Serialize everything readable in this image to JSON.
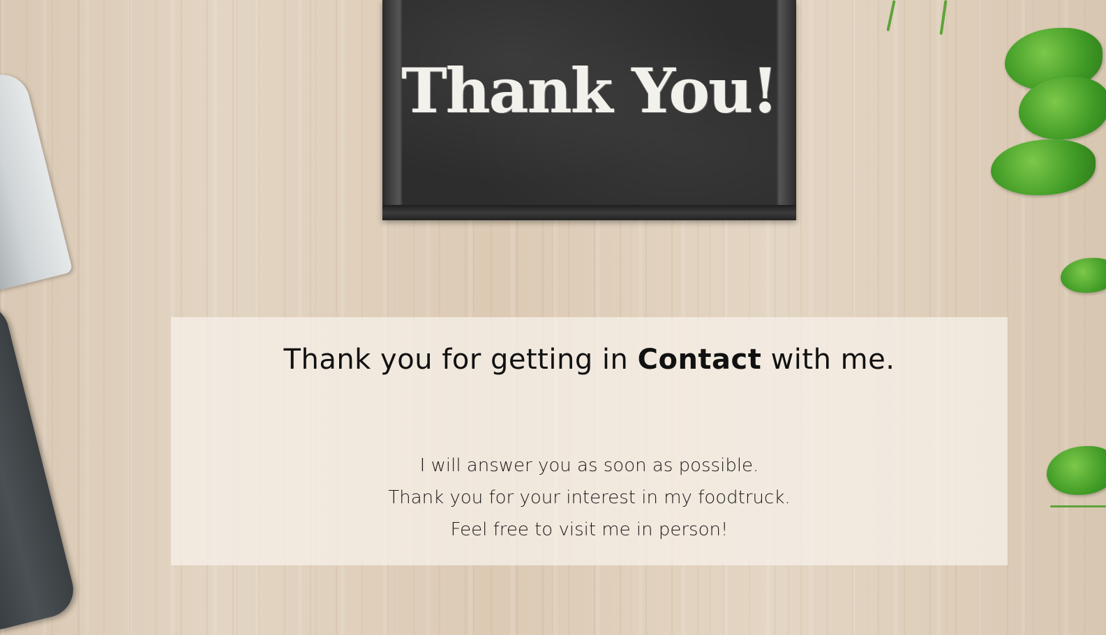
{
  "hero": {
    "chalkboard_text": "Thank You!"
  },
  "message": {
    "heading_before": "Thank you for getting in",
    "heading_emphasis": "Contact",
    "heading_after": "with me.",
    "lines": [
      "I will answer you as soon as possible.",
      "Thank you for your interest in my foodtruck.",
      "Feel free to visit me in person!"
    ]
  }
}
